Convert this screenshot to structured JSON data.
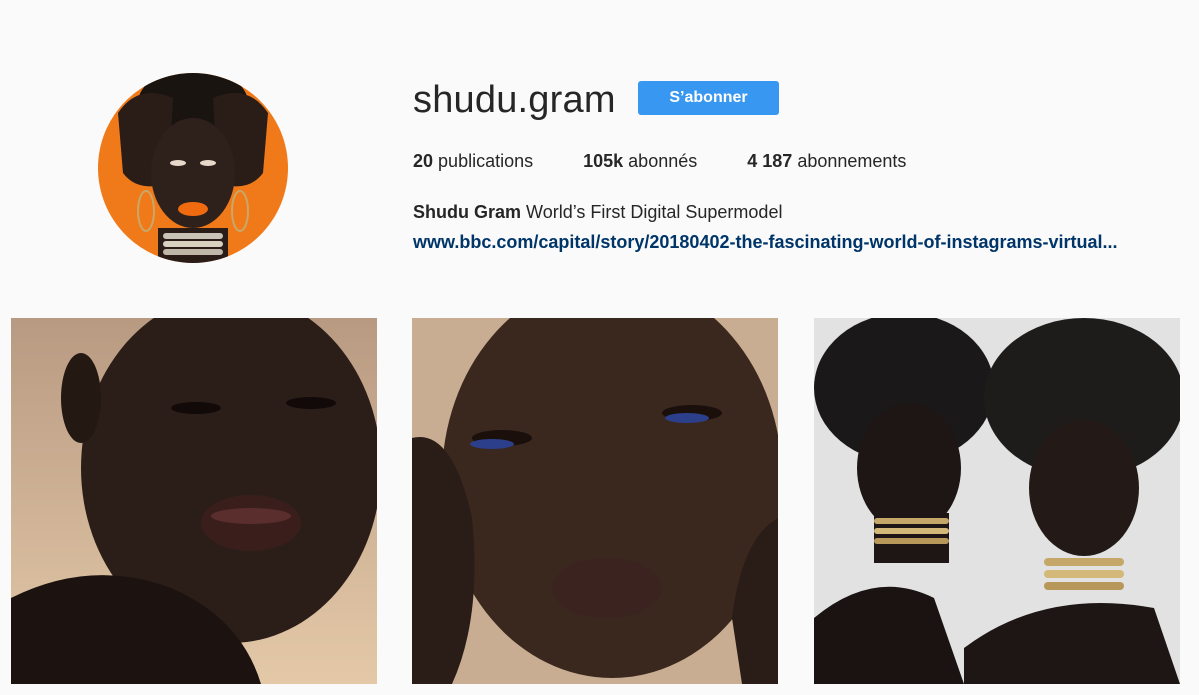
{
  "profile": {
    "username": "shudu.gram",
    "follow_label": "S’abonner",
    "avatar_icon": "profile-avatar-image",
    "stats": {
      "posts_count": "20",
      "posts_label": "publications",
      "followers_count": "105k",
      "followers_label": "abonnés",
      "following_count": "4 187",
      "following_label": "abonnements"
    },
    "bio_name": "Shudu Gram",
    "bio_text": "World’s First Digital Supermodel",
    "bio_link": "www.bbc.com/capital/story/20180402-the-fascinating-world-of-instagrams-virtual..."
  },
  "colors": {
    "background": "#fafafa",
    "follow_button": "#3897f0",
    "link": "#003569",
    "avatar_bg": "#f07a1a"
  },
  "posts": [
    {
      "icon": "portrait-photo-1"
    },
    {
      "icon": "portrait-photo-2"
    },
    {
      "icon": "portrait-photo-3"
    }
  ]
}
